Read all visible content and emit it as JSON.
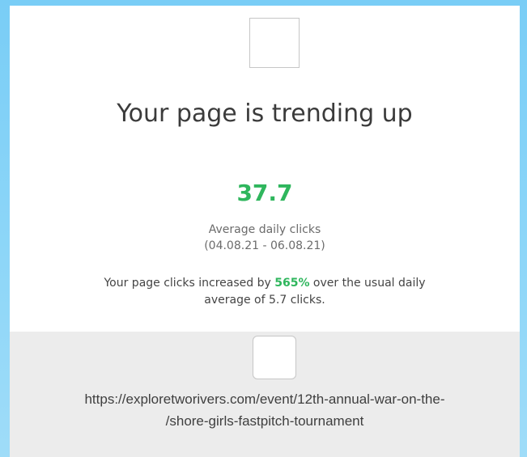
{
  "card": {
    "title": "Your page is trending up",
    "metric_value": "37.7",
    "metric_label": "Average daily clicks",
    "date_range": "(04.08.21 - 06.08.21)",
    "summary_before": "Your page clicks increased by ",
    "summary_percent": "565%",
    "summary_after_line1": " over the usual daily",
    "summary_after_line2": "average of 5.7 clicks.",
    "accent_color": "#2fb65d"
  },
  "link": {
    "url_line1": "https://exploretworivers.com/event/12th-annual-war-on-the-",
    "url_line2": "/shore-girls-fastpitch-tournament",
    "thumbnail_icon": "image-placeholder-icon"
  },
  "header": {
    "logo_icon": "image-placeholder-icon"
  }
}
